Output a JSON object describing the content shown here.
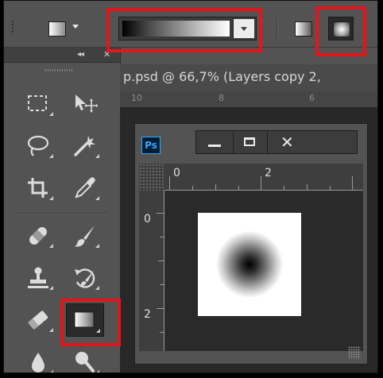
{
  "options_bar": {
    "tool_preset_icon": "gradient-preset-icon",
    "dropdown_icon": "chevron-down-icon",
    "gradient_type_buttons": [
      {
        "name": "linear-gradient",
        "icon": "linear-gradient-icon",
        "selected": false
      },
      {
        "name": "radial-gradient",
        "icon": "radial-gradient-icon",
        "selected": true
      }
    ]
  },
  "tools_panel": {
    "collapse_glyph": "◂◂",
    "close_glyph": "✕",
    "tools": [
      {
        "icon": "rectangular-marquee-icon"
      },
      {
        "icon": "move-icon"
      },
      {
        "icon": "lasso-icon"
      },
      {
        "icon": "magic-wand-icon"
      },
      {
        "icon": "crop-icon"
      },
      {
        "icon": "eyedropper-icon"
      },
      {
        "icon": "spot-healing-brush-icon"
      },
      {
        "icon": "brush-icon"
      },
      {
        "icon": "clone-stamp-icon"
      },
      {
        "icon": "history-brush-icon"
      },
      {
        "icon": "eraser-icon"
      },
      {
        "icon": "gradient-tool-icon",
        "active": true
      },
      {
        "icon": "blur-drop-icon"
      },
      {
        "icon": "dodge-icon"
      }
    ]
  },
  "document": {
    "tab_title": "p.psd @ 66,7% (Layers copy 2,",
    "ruler_labels": [
      "10",
      "8",
      "6"
    ]
  },
  "float_window": {
    "app_badge": "Ps",
    "top_ruler_labels": [
      "0",
      "2"
    ],
    "left_ruler_labels": [
      "0",
      "2"
    ],
    "close_glyph": "✕"
  },
  "highlight_color": "#e4151b"
}
